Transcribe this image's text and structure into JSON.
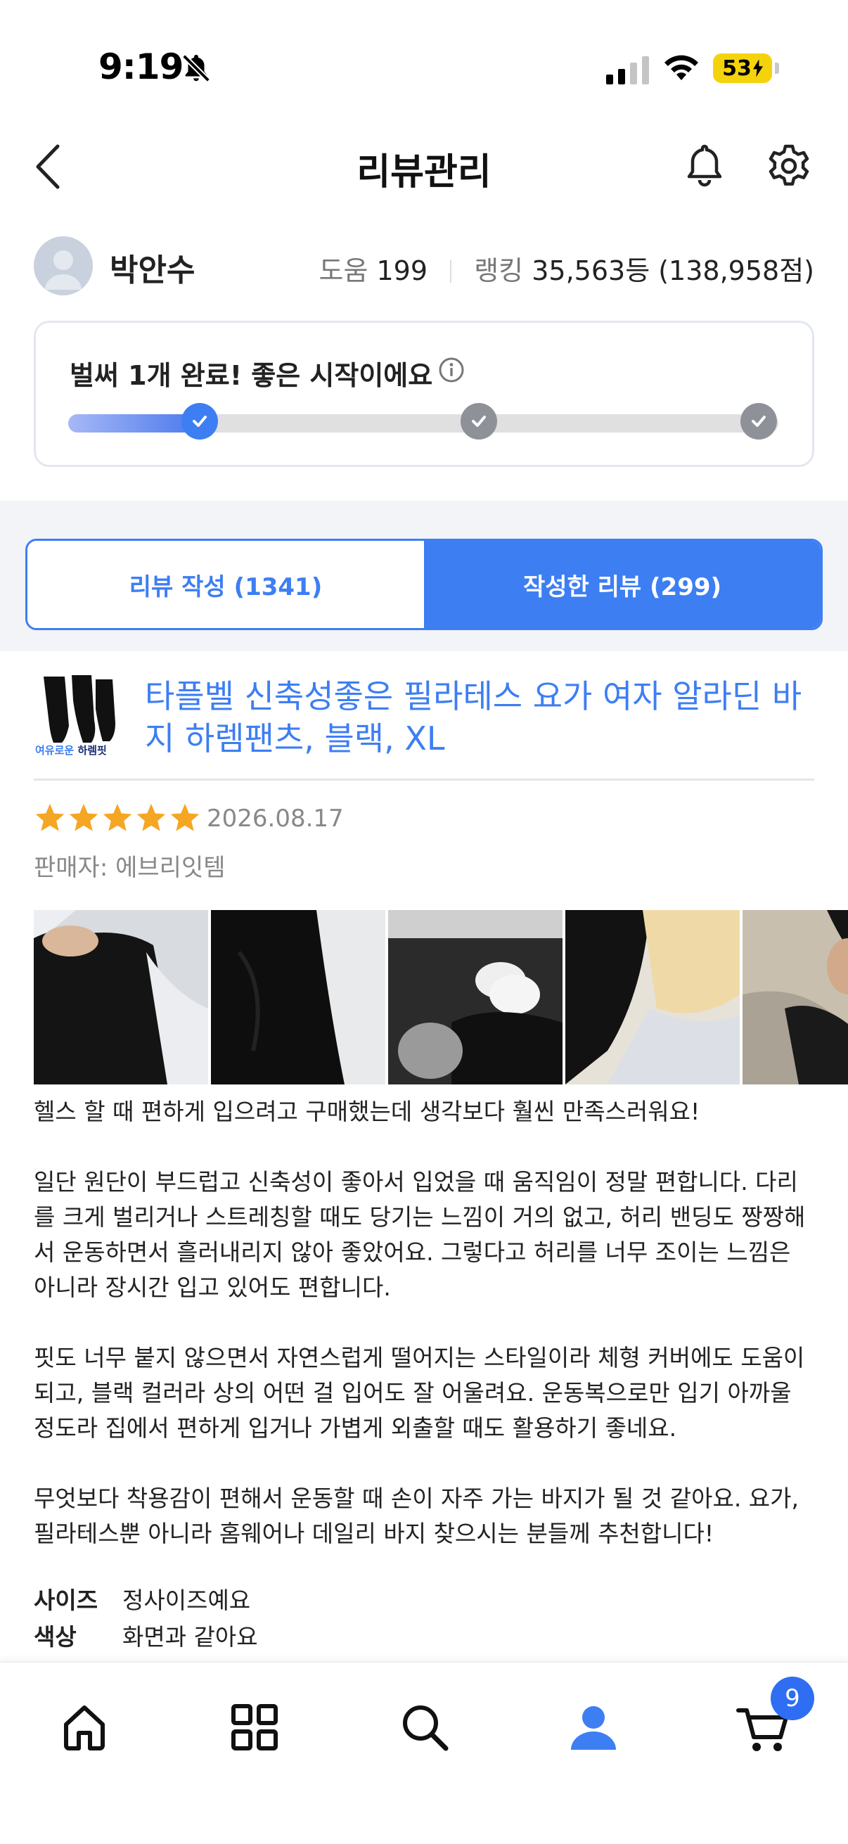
{
  "status_bar": {
    "time": "9:19",
    "battery": "53"
  },
  "header": {
    "title": "리뷰관리"
  },
  "profile": {
    "name": "박안수",
    "help_label": "도움",
    "help_count": "199",
    "ranking_label": "랭킹",
    "ranking_value": "35,563등 (138,958점)"
  },
  "progress": {
    "message": "벌써 1개 완료! 좋은 시작이에요",
    "completed_steps": 1,
    "total_steps": 3
  },
  "tabs": {
    "write": "리뷰 작성 (1341)",
    "written": "작성한 리뷰 (299)"
  },
  "product": {
    "name": "타플벨 신축성좋은 필라테스 요가 여자 알라딘 바지 하렘팬츠, 블랙, XL",
    "thumb_caption_a": "여유로운",
    "thumb_caption_b": "하렘핏"
  },
  "review": {
    "rating": 5,
    "date": "2026.08.17",
    "seller": "판매자: 에브리잇템",
    "paragraphs": [
      "헬스 할 때 편하게 입으려고 구매했는데 생각보다 훨씬 만족스러워요!",
      "일단 원단이 부드럽고 신축성이 좋아서 입었을 때 움직임이 정말 편합니다. 다리를 크게 벌리거나 스트레칭할 때도 당기는 느낌이 거의 없고, 허리 밴딩도 짱짱해서 운동하면서 흘러내리지 않아 좋았어요. 그렇다고 허리를 너무 조이는 느낌은 아니라 장시간 입고 있어도 편합니다.",
      "핏도 너무 붙지 않으면서 자연스럽게 떨어지는 스타일이라 체형 커버에도 도움이 되고, 블랙 컬러라 상의 어떤 걸 입어도 잘 어울려요. 운동복으로만 입기 아까울 정도라 집에서 편하게 입거나 가볍게 외출할 때도 활용하기 좋네요.",
      "무엇보다 착용감이 편해서 운동할 때 손이 자주 가는 바지가 될 것 같아요. 요가, 필라테스뿐 아니라 홈웨어나 데일리 바지 찾으시는 분들께 추천합니다!"
    ],
    "attributes": [
      {
        "key": "사이즈",
        "value": "정사이즈예요"
      },
      {
        "key": "색상",
        "value": "화면과 같아요"
      }
    ]
  },
  "bottom_nav": {
    "items": [
      "home-icon",
      "grid-icon",
      "search-icon",
      "person-icon",
      "cart-icon"
    ],
    "cart_count": "9"
  },
  "colors": {
    "accent": "#3d7ef3",
    "star": "#f5a623",
    "battery": "#f5d30c"
  }
}
